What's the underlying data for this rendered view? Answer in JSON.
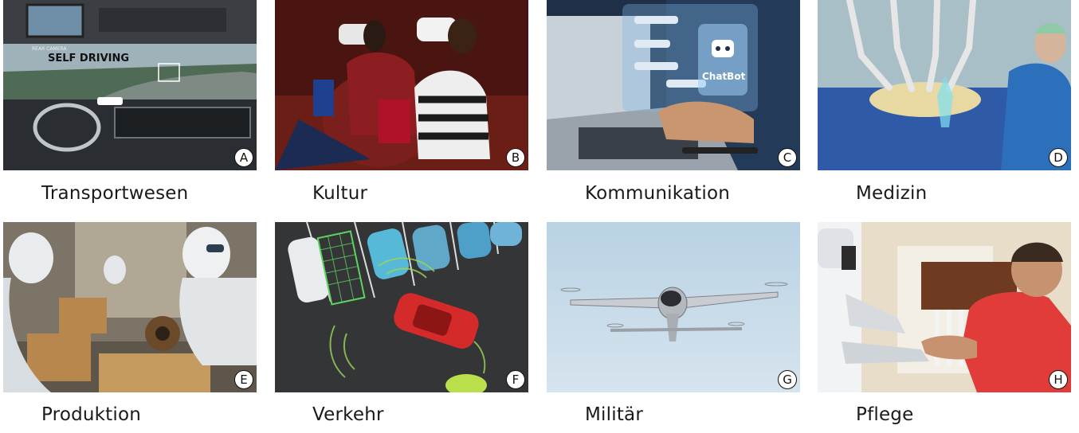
{
  "tiles": [
    {
      "letter": "A",
      "caption": "Transportwesen",
      "overlay_1": "SELF DRIVING",
      "overlay_2": "REAR CAMERA"
    },
    {
      "letter": "B",
      "caption": "Kultur"
    },
    {
      "letter": "C",
      "caption": "Kommunikation",
      "overlay_1": "ChatBot"
    },
    {
      "letter": "D",
      "caption": "Medizin"
    },
    {
      "letter": "E",
      "caption": "Produktion"
    },
    {
      "letter": "F",
      "caption": "Verkehr"
    },
    {
      "letter": "G",
      "caption": "Militär"
    },
    {
      "letter": "H",
      "caption": "Pflege"
    }
  ]
}
